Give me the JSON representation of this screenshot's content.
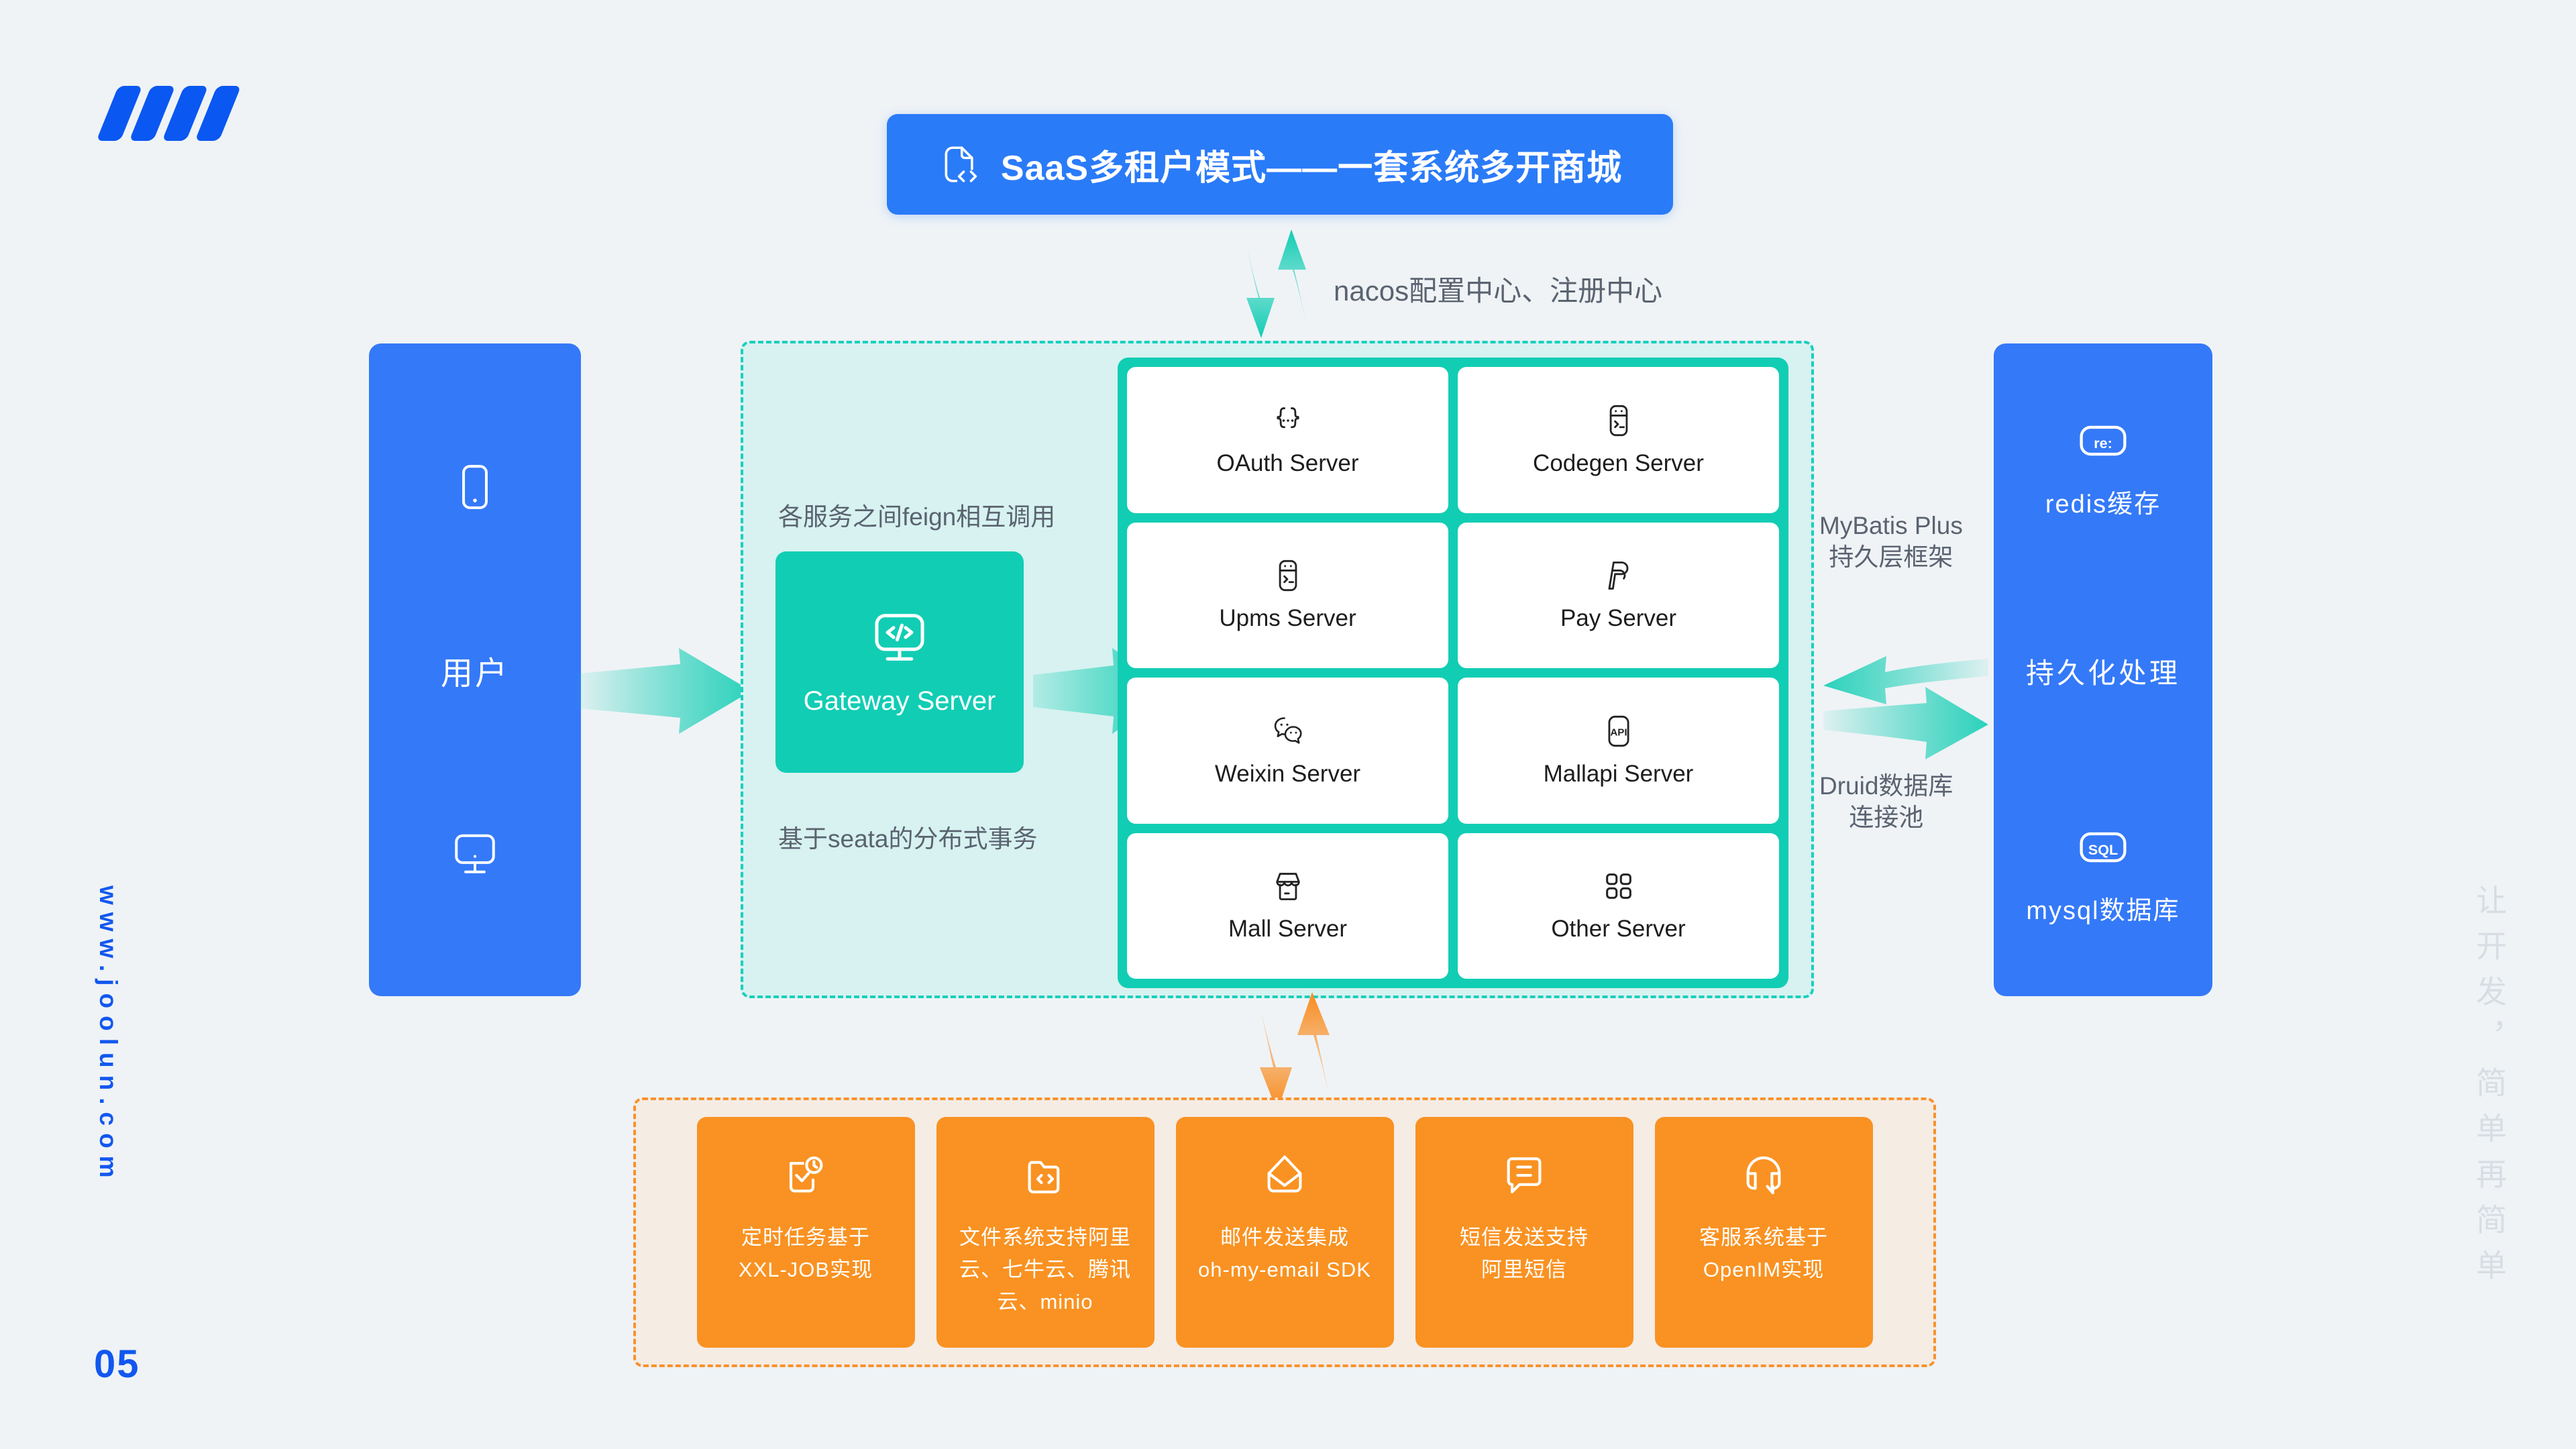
{
  "brand": {
    "logo_name": "joolun-logo",
    "site_url": "www.joolun.com",
    "page_number": "05",
    "slogan": "让开发，简单再简单",
    "blue": "#3479f8",
    "teal": "#11cdb4",
    "orange": "#f99222"
  },
  "title": {
    "icon": "code-file-icon",
    "text": "SaaS多租户模式——一套系统多开商城"
  },
  "nacos": {
    "label": "nacos配置中心、注册中心",
    "arrow_icon": "bidirectional-vertical-arrow-icon"
  },
  "user": {
    "phone_icon": "mobile-phone-icon",
    "label": "用户",
    "desktop_icon": "desktop-monitor-icon"
  },
  "middle": {
    "feign_label": "各服务之间feign相互调用",
    "seata_label": "基于seata的分布式事务",
    "gateway": {
      "icon": "code-monitor-icon",
      "label": "Gateway Server"
    }
  },
  "services": [
    {
      "icon": "braces-icon",
      "label": "OAuth Server"
    },
    {
      "icon": "terminal-icon",
      "label": "Codegen Server"
    },
    {
      "icon": "terminal-icon",
      "label": "Upms Server"
    },
    {
      "icon": "paypal-icon",
      "label": "Pay Server"
    },
    {
      "icon": "wechat-icon",
      "label": "Weixin Server"
    },
    {
      "icon": "api-icon",
      "label": "Mallapi Server"
    },
    {
      "icon": "storefront-icon",
      "label": "Mall Server"
    },
    {
      "icon": "grid-squares-icon",
      "label": "Other Server"
    }
  ],
  "side_labels": {
    "mybatis": "MyBatis Plus\n持久层框架",
    "mybatis_line1": "MyBatis Plus",
    "mybatis_line2": "持久层框架",
    "druid_line1": "Druid数据库",
    "druid_line2": "连接池"
  },
  "database": {
    "redis_icon": "redis-icon",
    "redis_label": "redis缓存",
    "middle_label": "持久化处理",
    "mysql_icon": "sql-database-icon",
    "mysql_label": "mysql数据库"
  },
  "bottom": {
    "arrow_icon": "bidirectional-vertical-arrow-orange-icon",
    "cards": [
      {
        "icon": "clock-task-icon",
        "line1": "定时任务基于",
        "line2": "XXL-JOB实现",
        "line3": ""
      },
      {
        "icon": "folder-code-icon",
        "line1": "文件系统支持阿里",
        "line2": "云、七牛云、腾讯",
        "line3": "云、minio"
      },
      {
        "icon": "envelope-icon",
        "line1": "邮件发送集成",
        "line2": "oh-my-email SDK",
        "line3": ""
      },
      {
        "icon": "sms-bubble-icon",
        "line1": "短信发送支持",
        "line2": "阿里短信",
        "line3": ""
      },
      {
        "icon": "headset-chat-icon",
        "line1": "客服系统基于",
        "line2": "OpenIM实现",
        "line3": ""
      }
    ]
  }
}
